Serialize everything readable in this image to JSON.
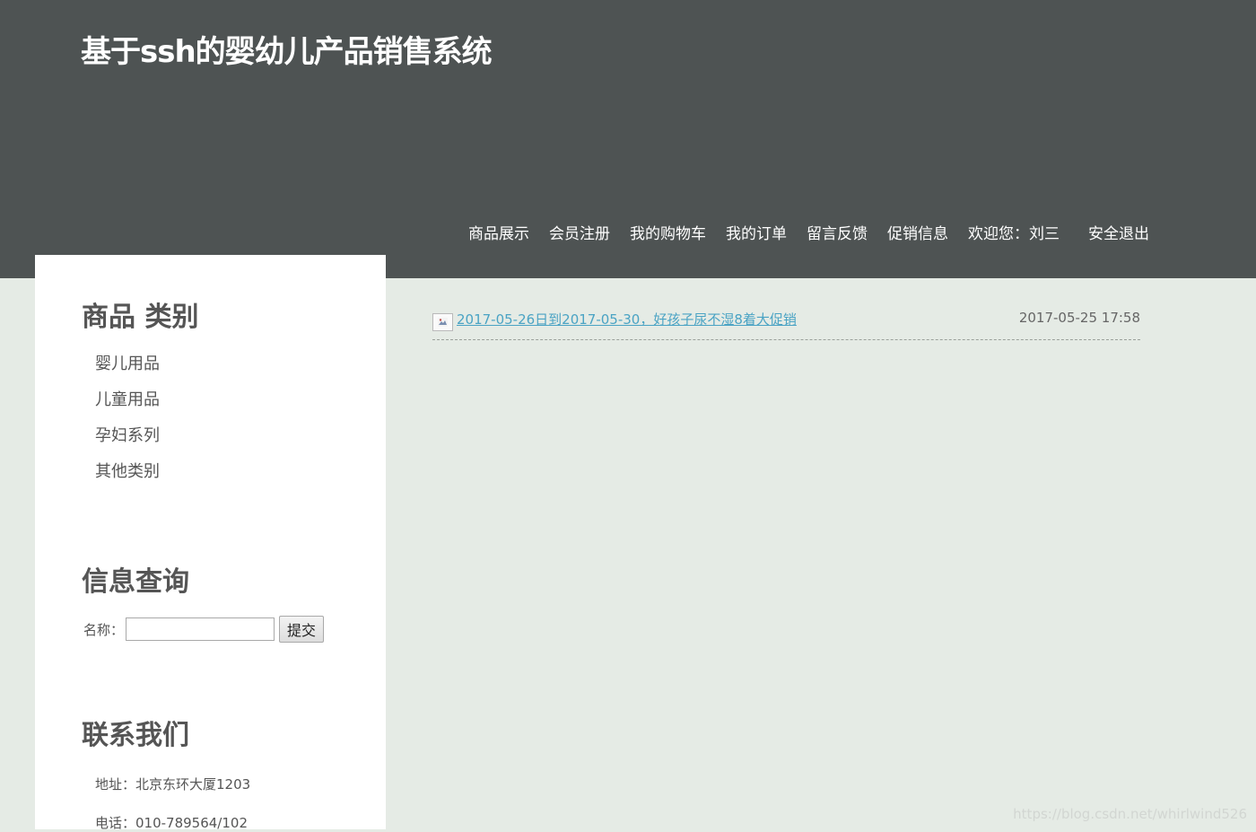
{
  "header": {
    "title": "基于ssh的婴幼儿产品销售系统",
    "nav": [
      {
        "label": "商品展示"
      },
      {
        "label": "会员注册"
      },
      {
        "label": "我的购物车"
      },
      {
        "label": "我的订单"
      },
      {
        "label": "留言反馈"
      },
      {
        "label": "促销信息"
      }
    ],
    "welcome": "欢迎您：刘三",
    "logout": "安全退出"
  },
  "sidebar": {
    "categories": {
      "heading": "商品 类别",
      "items": [
        "婴儿用品",
        "儿童用品",
        "孕妇系列",
        "其他类别"
      ]
    },
    "search": {
      "heading": "信息查询",
      "label": "名称：",
      "value": "",
      "submit": "提交"
    },
    "contact": {
      "heading": "联系我们",
      "address": "地址：北京东环大厦1203",
      "phone": "电话：010-789564/102"
    }
  },
  "main": {
    "promotions": [
      {
        "icon": "broken-image-icon",
        "title": "2017-05-26日到2017-05-30，好孩子尿不湿8着大促销",
        "date": "2017-05-25 17:58"
      }
    ]
  },
  "watermark": "https://blog.csdn.net/whirlwind526",
  "colors": {
    "header_bg": "#4e5353",
    "page_bg": "#e5ebe5",
    "link": "#4aa3c4"
  }
}
